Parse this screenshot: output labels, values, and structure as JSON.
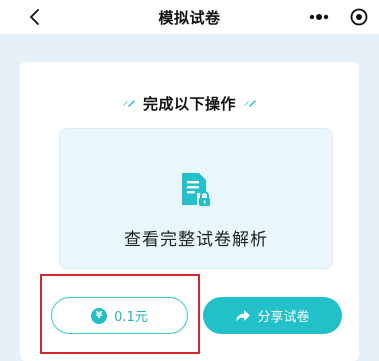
{
  "navbar": {
    "title": "模拟试卷",
    "back_icon": "chevron-left-icon",
    "more_icon": "more-dots-icon",
    "close_icon": "target-close-icon"
  },
  "card": {
    "section_title": "完成以下操作",
    "feature": {
      "icon": "document-lock-icon",
      "label": "查看完整试卷解析"
    },
    "price_button": {
      "icon": "yen-icon",
      "icon_glyph": "¥",
      "label": "0.1元"
    },
    "share_button": {
      "icon": "share-arrow-icon",
      "label": "分享试卷"
    }
  },
  "colors": {
    "accent": "#22c0c8",
    "page_background": "#e6f1f7",
    "feature_background": "#e9f6fb",
    "highlight": "#d8262e"
  }
}
